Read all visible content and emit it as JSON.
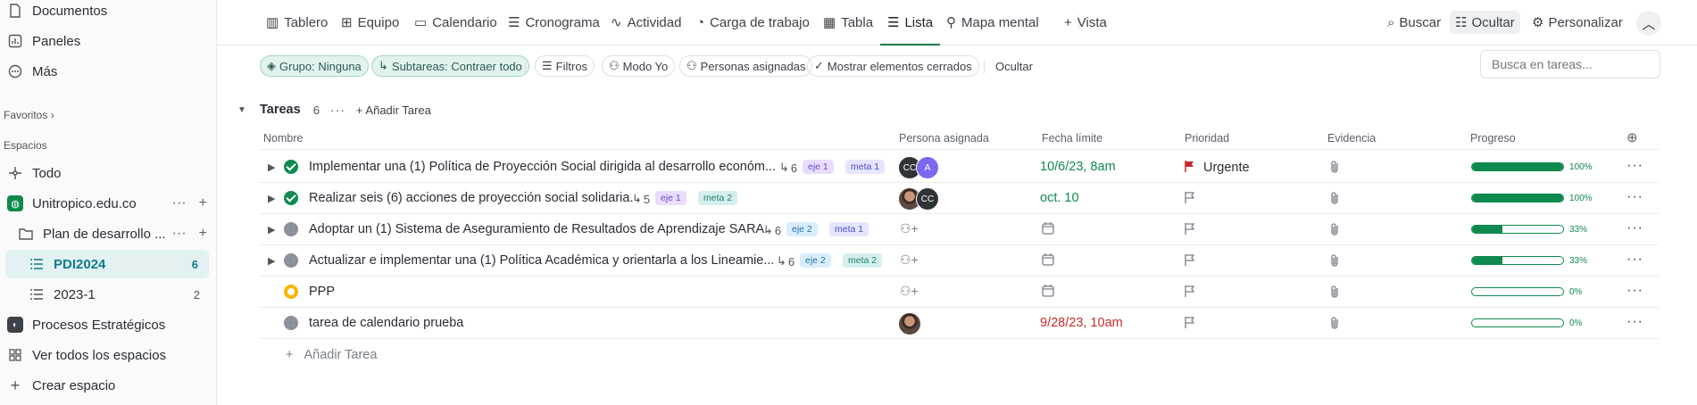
{
  "sidebar": {
    "items": [
      {
        "label": "Documentos",
        "icon": "document-icon"
      },
      {
        "label": "Paneles",
        "icon": "dashboard-icon"
      },
      {
        "label": "Más",
        "icon": "more-circle-icon"
      }
    ],
    "favorites_label": "Favoritos",
    "spaces_label": "Espacios",
    "all_label": "Todo",
    "workspace": "Unitropico.edu.co",
    "folder": "Plan de desarrollo ...",
    "lists": [
      {
        "label": "PDI2024",
        "count": "6",
        "active": true
      },
      {
        "label": "2023-1",
        "count": "2",
        "active": false
      }
    ],
    "space2": "Procesos Estratégicos",
    "view_all": "Ver todos los espacios",
    "create": "Crear espacio"
  },
  "views": {
    "tabs": [
      "Tablero",
      "Equipo",
      "Calendario",
      "Cronograma",
      "Actividad",
      "Carga de trabajo",
      "Tabla",
      "Lista",
      "Mapa mental"
    ],
    "active": "Lista",
    "add_view": "Vista",
    "search": "Buscar",
    "hide": "Ocultar",
    "customize": "Personalizar"
  },
  "filters": {
    "group": "Grupo: Ninguna",
    "subtasks": "Subtareas: Contraer todo",
    "filters": "Filtros",
    "me_mode": "Modo Yo",
    "assignees": "Personas asignadas",
    "show_closed": "Mostrar elementos cerrados",
    "hide": "Ocultar",
    "search_placeholder": "Busca en tareas..."
  },
  "group": {
    "title": "Tareas",
    "count": "6",
    "add": "Añadir Tarea"
  },
  "columns": {
    "name": "Nombre",
    "assignee": "Persona asignada",
    "due": "Fecha límite",
    "priority": "Prioridad",
    "evidence": "Evidencia",
    "progress": "Progreso"
  },
  "tasks": [
    {
      "name": "Implementar una (1) Política de Proyección Social dirigida al desarrollo económ...",
      "subtasks": "6",
      "tags": [
        "eje 1",
        "meta 1"
      ],
      "assignees": [
        "CC",
        "A"
      ],
      "due": "10/6/23, 8am",
      "priority": "Urgente",
      "progress": 1.0,
      "progress_label": "100%",
      "status": "done"
    },
    {
      "name": "Realizar seis (6) acciones de proyección social solidaria.",
      "subtasks": "5",
      "tags": [
        "eje 1",
        "meta 2"
      ],
      "assignees": [
        "photo",
        "CC"
      ],
      "due": "oct. 10",
      "priority": "",
      "progress": 1.0,
      "progress_label": "100%",
      "status": "done"
    },
    {
      "name": "Adoptar un (1) Sistema de Aseguramiento de Resultados de Aprendizaje SARA.",
      "subtasks": "6",
      "tags": [
        "eje 2",
        "meta 1"
      ],
      "assignees": [],
      "due": "",
      "priority": "",
      "progress": 0.33,
      "progress_label": "33%",
      "status": "open"
    },
    {
      "name": "Actualizar e implementar una (1) Política Académica y orientarla a los Lineamie...",
      "subtasks": "6",
      "tags": [
        "eje 2",
        "meta 2"
      ],
      "assignees": [],
      "due": "",
      "priority": "",
      "progress": 0.33,
      "progress_label": "33%",
      "status": "open"
    },
    {
      "name": "PPP",
      "subtasks": "",
      "tags": [],
      "assignees": [],
      "due": "",
      "priority": "",
      "progress": 0,
      "progress_label": "0%",
      "status": "in-progress"
    },
    {
      "name": "tarea de calendario prueba",
      "subtasks": "",
      "tags": [],
      "assignees": [
        "photo"
      ],
      "due": "9/28/23, 10am",
      "priority": "",
      "progress": 0,
      "progress_label": "0%",
      "status": "open"
    }
  ],
  "add_task": "Añadir Tarea",
  "colors": {
    "accent": "#0f8a4f",
    "urgent": "#c52b2b",
    "active_bg": "#e3f1f3"
  }
}
